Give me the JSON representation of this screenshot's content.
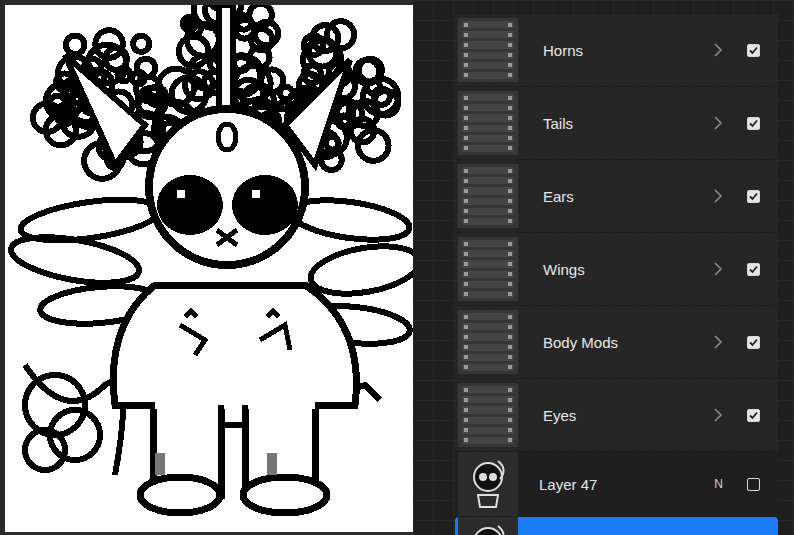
{
  "layers": [
    {
      "name": "Horns",
      "kind": "group",
      "visible": true,
      "selected": false
    },
    {
      "name": "Tails",
      "kind": "group",
      "visible": true,
      "selected": false
    },
    {
      "name": "Ears",
      "kind": "group",
      "visible": true,
      "selected": false
    },
    {
      "name": "Wings",
      "kind": "group",
      "visible": true,
      "selected": false
    },
    {
      "name": "Body Mods",
      "kind": "group",
      "visible": true,
      "selected": false
    },
    {
      "name": "Eyes",
      "kind": "group",
      "visible": true,
      "selected": false
    },
    {
      "name": "Layer 47",
      "kind": "layer",
      "blend": "N",
      "visible": false,
      "selected": false
    },
    {
      "kind": "layer",
      "visible": true,
      "selected": true
    }
  ]
}
